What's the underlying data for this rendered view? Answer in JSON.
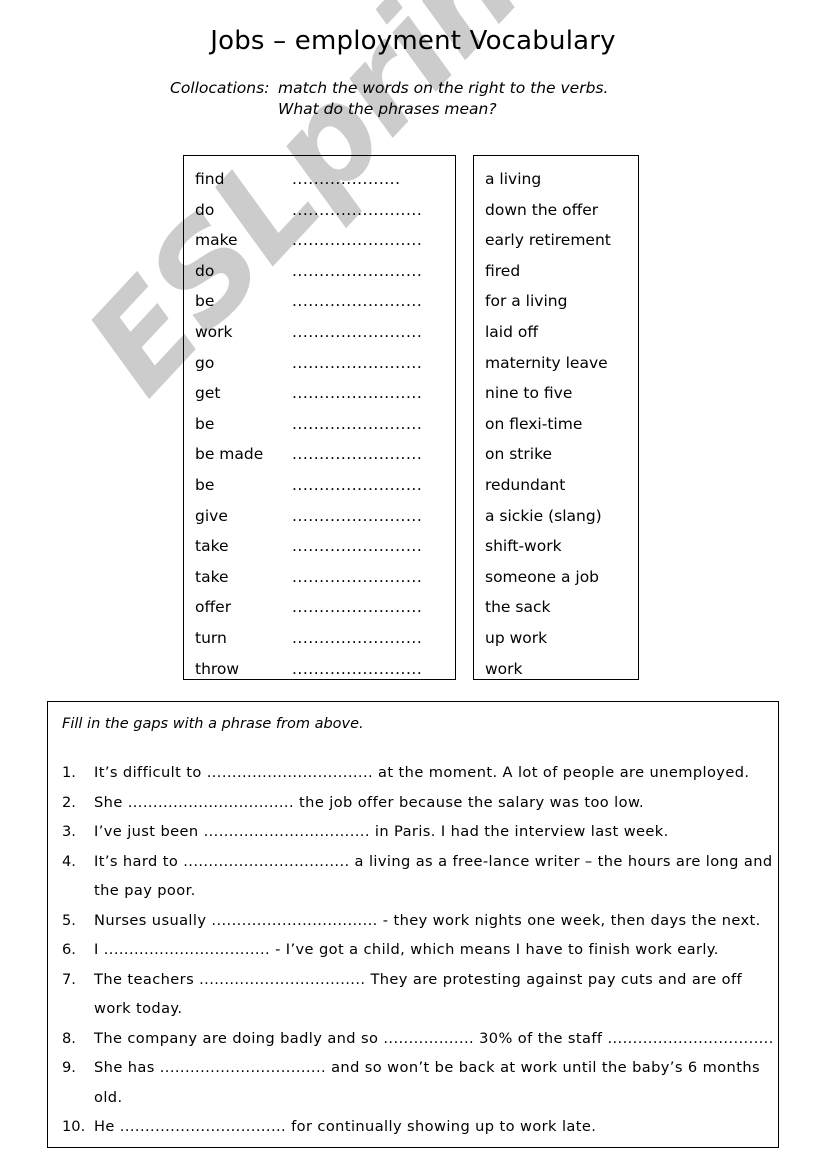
{
  "title": "Jobs – employment Vocabulary",
  "instructions": {
    "lead": "Collocations:",
    "line1": "match the words on the right to the verbs.",
    "line2": "What do the phrases mean?"
  },
  "watermark": {
    "text": "ESLprintables.com",
    "color": "#cccccc"
  },
  "match_exercise": {
    "verbs": [
      "find",
      "do",
      "make",
      "do",
      "be",
      "work",
      "go",
      "get",
      "be",
      "be made",
      "be",
      "give",
      "take",
      "take",
      "offer",
      "turn",
      "throw"
    ],
    "answer_dots": [
      "....................",
      "........................",
      "........................",
      "........................",
      "........................",
      "........................",
      "........................",
      "........................",
      "........................",
      "........................",
      "........................",
      "........................",
      "........................",
      "........................",
      "........................",
      "........................",
      "........................"
    ],
    "phrases": [
      "a living",
      "down the offer",
      "early retirement",
      "fired",
      "for a living",
      "laid off",
      "maternity leave",
      "nine to five",
      "on flexi-time",
      "on strike",
      "redundant",
      "a sickie (slang)",
      "shift-work",
      "someone a job",
      "the sack",
      "up work",
      "work"
    ]
  },
  "gapfill": {
    "heading": "Fill in the gaps with a phrase from above.",
    "items": [
      {
        "number": "1.",
        "text": "It’s difficult to ................................. at the moment.   A lot of people are unemployed."
      },
      {
        "number": "2.",
        "text": "She ................................. the job offer because the salary was too low."
      },
      {
        "number": "3.",
        "text": "I’ve just been ................................. in Paris.  I had the interview last week."
      },
      {
        "number": "4.",
        "text": "It’s hard to ................................. a living as a free-lance writer – the hours are long and the pay poor."
      },
      {
        "number": "5.",
        "text": "Nurses usually ................................. - they work nights one week, then days the next."
      },
      {
        "number": "6.",
        "text": "I  ................................. - I’ve got a child, which means I have to finish work early."
      },
      {
        "number": "7.",
        "text": "The teachers .................................   They are protesting against pay cuts and are off work today."
      },
      {
        "number": "8.",
        "text": "The company are doing badly and so .................. 30% of the staff ................................."
      },
      {
        "number": "9.",
        "text": "She has  ................................. and so won’t be back at work until the baby’s 6 months old."
      },
      {
        "number": "10.",
        "text": "He ................................. for continually showing up to work late."
      }
    ]
  }
}
